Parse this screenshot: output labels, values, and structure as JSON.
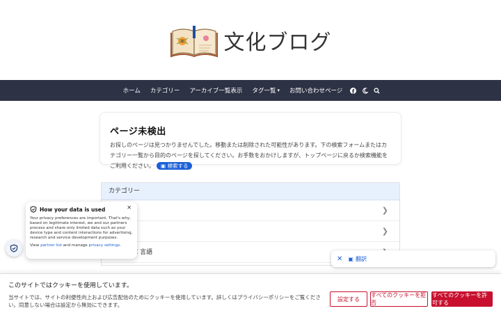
{
  "header": {
    "site_title": "文化ブログ"
  },
  "nav": {
    "items": [
      {
        "label": "ホーム"
      },
      {
        "label": "カテゴリー"
      },
      {
        "label": "アーカイブ一覧表示"
      },
      {
        "label": "タグ一覧"
      },
      {
        "label": "お問い合わせページ"
      }
    ]
  },
  "card": {
    "title": "ページ未検出",
    "text": "お探しのページは見つかりませんでした。移動または削除された可能性があります。下の検索フォームまたはカテゴリー一覧から目的のページを探してください。お手数をおかけしますが、トップページに戻るか検索機能をご利用ください。",
    "badge": "検索する"
  },
  "archive": {
    "heading": "カテゴリー",
    "rows": [
      "",
      "",
      "C 言語"
    ]
  },
  "privacy_popup": {
    "title": "How your data is used",
    "body": "Your privacy preferences are important. That's why, based on legitimate interest, we and our partners process and share only limited data such as your device type and content interactions for advertising, research and service development purposes.",
    "view_prefix": "View",
    "partner_list": "partner list",
    "manage_text": "and manage",
    "privacy_settings": "privacy settings",
    "period": "."
  },
  "translate_bar": {
    "label": "翻訳"
  },
  "cookie": {
    "title": "このサイトではクッキーを使用しています。",
    "text": "当サイトでは、サイトの利便性向上および広告配信のためにクッキーを使用しています。詳しくはプライバシーポリシーをご覧ください。同意しない場合は設定から無効にできます。",
    "btn_settings": "設定する",
    "btn_reject": "すべてのクッキーを拒否",
    "btn_accept": "すべてのクッキーを許可する"
  }
}
